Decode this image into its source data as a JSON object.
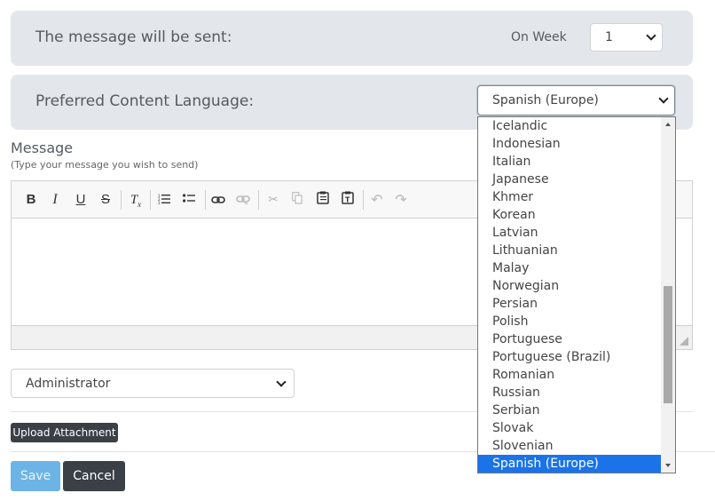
{
  "schedule": {
    "label": "The message will be sent:",
    "on_week_label": "On Week",
    "week_value": "1"
  },
  "language": {
    "label": "Preferred Content Language:",
    "selected": "Spanish (Europe)",
    "options": [
      "Icelandic",
      "Indonesian",
      "Italian",
      "Japanese",
      "Khmer",
      "Korean",
      "Latvian",
      "Lithuanian",
      "Malay",
      "Norwegian",
      "Persian",
      "Polish",
      "Portuguese",
      "Portuguese (Brazil)",
      "Romanian",
      "Russian",
      "Serbian",
      "Slovak",
      "Slovenian",
      "Spanish (Europe)"
    ]
  },
  "message": {
    "title": "Message",
    "hint": "(Type your message you wish to send)",
    "toolbar_icons": [
      "bold-icon",
      "italic-icon",
      "underline-icon",
      "strikethrough-icon",
      "remove-format-icon",
      "numbered-list-icon",
      "bulleted-list-icon",
      "link-icon",
      "unlink-icon",
      "cut-icon",
      "copy-icon",
      "paste-icon",
      "paste-text-icon",
      "undo-icon",
      "redo-icon"
    ]
  },
  "sender": {
    "selected": "Administrator"
  },
  "actions": {
    "upload": "Upload Attachment",
    "save": "Save",
    "cancel": "Cancel"
  },
  "colors": {
    "panel_bg": "#e3e6ea",
    "dark_button": "#3a4046",
    "save_button": "#6cb4e6",
    "selected_option": "#1a73e8"
  }
}
